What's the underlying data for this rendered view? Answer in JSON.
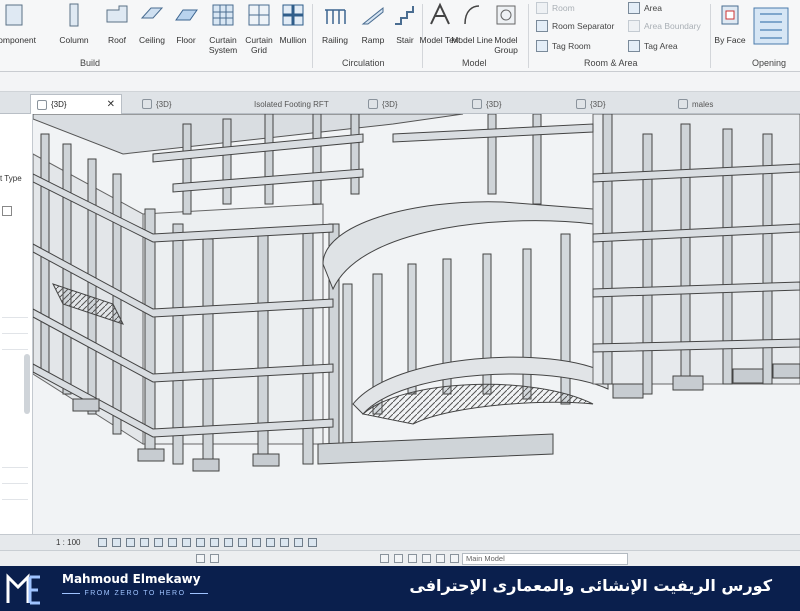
{
  "ribbon": {
    "build": {
      "buttons": [
        "Component",
        "Column",
        "Roof",
        "Ceiling",
        "Floor",
        "Curtain System",
        "Curtain Grid",
        "Mullion"
      ],
      "group_label": "Build"
    },
    "circulation": {
      "buttons": [
        "Railing",
        "Ramp",
        "Stair"
      ],
      "group_label": "Circulation"
    },
    "model": {
      "buttons": [
        "Model Text",
        "Model Line",
        "Model Group"
      ],
      "group_label": "Model"
    },
    "room_area": {
      "rows": [
        "Room",
        "Room Separator",
        "Tag Room",
        "Area",
        "Area Boundary",
        "Tag Area"
      ],
      "group_label": "Room & Area"
    },
    "opening": {
      "buttons": [
        "By Face"
      ],
      "group_label": "Opening"
    }
  },
  "tabs": [
    {
      "label": "{3D}",
      "close": "✕"
    },
    {
      "label": "{3D}"
    },
    {
      "label": "Isolated Footing RFT"
    },
    {
      "label": "{3D}"
    },
    {
      "label": "{3D}"
    },
    {
      "label": "{3D}"
    },
    {
      "label": "males"
    }
  ],
  "left_panel": {
    "type_label": "t Type"
  },
  "view_bar": {
    "scale": "1 : 100"
  },
  "status_bar": {
    "model_dropdown": "Main Model"
  },
  "footer": {
    "name": "Mahmoud Elmekawy",
    "tagline": "FROM ZERO TO HERO",
    "course_title": "كورس الريفيت الإنشائى والمعمارى الإحترافى"
  },
  "colors": {
    "footer_bg": "#0a1f4d",
    "ribbon_bg": "#f6f7f8",
    "viewport_bg": "#f1f3f5"
  }
}
